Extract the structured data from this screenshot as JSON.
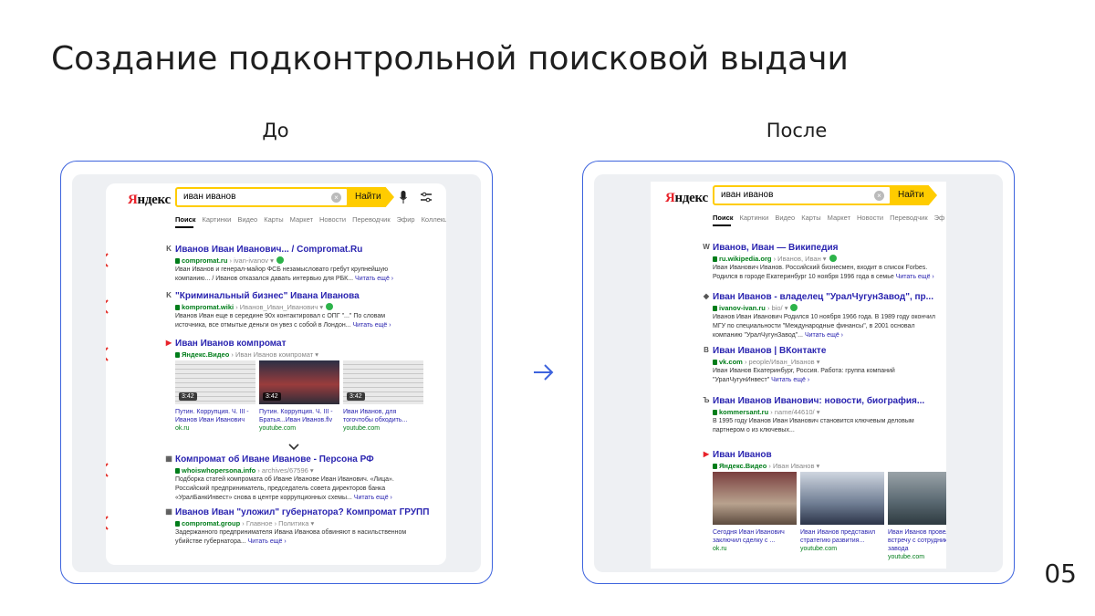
{
  "slide": {
    "title": "Создание подконтрольной поисковой выдачи",
    "before_label": "До",
    "after_label": "После",
    "page_number": "05"
  },
  "serp": {
    "logo_first": "Я",
    "logo_rest": "ндекс",
    "query": "иван иванов",
    "search_button": "Найти"
  },
  "before": {
    "tabs": [
      "Поиск",
      "Картинки",
      "Видео",
      "Карты",
      "Маркет",
      "Новости",
      "Переводчик",
      "Эфир",
      "Коллекции"
    ],
    "results": [
      {
        "favicon": "K",
        "title": "Иванов Иван Иванович... / Compromat.Ru",
        "domain": "compromat.ru",
        "path": " › ivan-ivanov ▾",
        "snippet": "Иван Иванов и генерал-майор ФСБ незамысловато гребут крупнейшую компанию... / Иванов отказался давать интервью для РБК...",
        "more": "Читать ещё ›",
        "verdict": "bad"
      },
      {
        "favicon": "K",
        "title": "\"Криминальный бизнес\" Ивана Иванова",
        "domain": "kompromat.wiki",
        "path": " › Иванов_Иван_Иванович ▾",
        "snippet": "Иванов Иван еще в середине 90х контактировал с ОПГ \"...\" По словам источника, все отмытые деньги он увез с собой в Лондон...",
        "more": "Читать ещё ›",
        "verdict": "bad"
      },
      {
        "favicon": "▶",
        "title": "Иван Иванов компромат",
        "domain": "Яндекс.Видео",
        "path": " › Иван Иванов компромат ▾",
        "verdict": "bad",
        "videos": [
          {
            "duration": "3:42",
            "caption": "Путин. Коррупция. Ч. III - Иванов Иван Иванович",
            "source": "ok.ru"
          },
          {
            "duration": "3:42",
            "caption": "Путин. Коррупция. Ч. III - Братья...Иван Иванов.flv",
            "source": "youtube.com"
          },
          {
            "duration": "3:42",
            "caption": "Иван Иванов, для тогочтобы обходить...",
            "source": "youtube.com"
          }
        ]
      },
      {
        "favicon": "▦",
        "title": "Компромат об Иване Иванове - Персона РФ",
        "domain": "whoiswhopersona.info",
        "path": " › archives/67596 ▾",
        "snippet": "Подборка статей компромата об Иване Иванове Иван Иванович. «Лица». Российский предприниматель, председатель совета директоров банка «УралБанкИнвест» снова в центре коррупционных схемы...",
        "more": "Читать ещё ›",
        "verdict": "bad"
      },
      {
        "favicon": "▦",
        "title": "Иванов Иван \"уложил\" губернатора? Компромат ГРУПП",
        "domain": "compromat.group",
        "path": " › Главное › Политика ▾",
        "snippet": "Задержанного предпринимателя Ивана Иванова обвиняют в насильственном убийстве губернатора...",
        "more": "Читать ещё ›",
        "verdict": "bad"
      }
    ]
  },
  "after": {
    "tabs": [
      "Поиск",
      "Картинки",
      "Видео",
      "Карты",
      "Маркет",
      "Новости",
      "Переводчик",
      "Эф"
    ],
    "results": [
      {
        "favicon": "W",
        "title": "Иванов, Иван — Википедия",
        "domain": "ru.wikipedia.org",
        "path": " › Иванов, Иван ▾",
        "snippet": "Иван Иванович Иванов. Российский бизнесмен, входит в список Forbes. Родился в городе Екатеринбург 10 ноября 1996 года в семье",
        "more": "Читать ещё ›",
        "verdict": "good"
      },
      {
        "favicon": "◆",
        "title": "Иван Иванов - владелец \"УралЧугунЗавод\", пр...",
        "domain": "ivanov-ivan.ru",
        "path": " › bio/ ▾",
        "snippet": "Иванов Иван Иванович Родился 10 ноября 1966 года. В 1989 году окончил МГУ по специальности \"Международные финансы\", в 2001 основал компанию \"УралЧугунЗавод\"...",
        "more": "Читать ещё ›",
        "verdict": "good"
      },
      {
        "favicon": "В",
        "title": "Иван Иванов | ВКонтакте",
        "domain": "vk.com",
        "path": " › people/Иван_Иванов ▾",
        "snippet": "Иван Иванов Екатеринбург, Россия. Работа: группа компаний \"УралЧугунИнвест\"",
        "more": "Читать ещё ›",
        "verdict": "good"
      },
      {
        "favicon": "Ъ",
        "title": "Иван Иванов Иванович: новости, биография...",
        "domain": "kommersant.ru",
        "path": " › name/44610/ ▾",
        "snippet": "В 1995 году Иванов Иван Иванович становится ключевым деловым партнером о из ключевых...",
        "more": "",
        "verdict": "good"
      },
      {
        "favicon": "▶",
        "title": "Иван Иванов",
        "domain": "Яндекс.Видео",
        "path": " › Иван Иванов ▾",
        "verdict": "good",
        "videos": [
          {
            "duration": "",
            "caption": "Сегодня Иван Иванович заключил сделку с ...",
            "source": "ok.ru"
          },
          {
            "duration": "",
            "caption": "Иван Иванов представил стратегию развития...",
            "source": "youtube.com"
          },
          {
            "duration": "",
            "caption": "Иван Иванов провел встречу с сотрудниками завода",
            "source": "youtube.com"
          }
        ]
      }
    ]
  },
  "colors": {
    "frame_border": "#3d63dd",
    "bad_mark": "#e5322d",
    "good_mark": "#2eb84b",
    "link": "#2a24b0",
    "url_green": "#007d1a",
    "yandex_yellow": "#ffcc00"
  },
  "icons": {
    "bad": "cross-icon",
    "good": "check-icon",
    "arrow": "arrow-right-icon"
  }
}
